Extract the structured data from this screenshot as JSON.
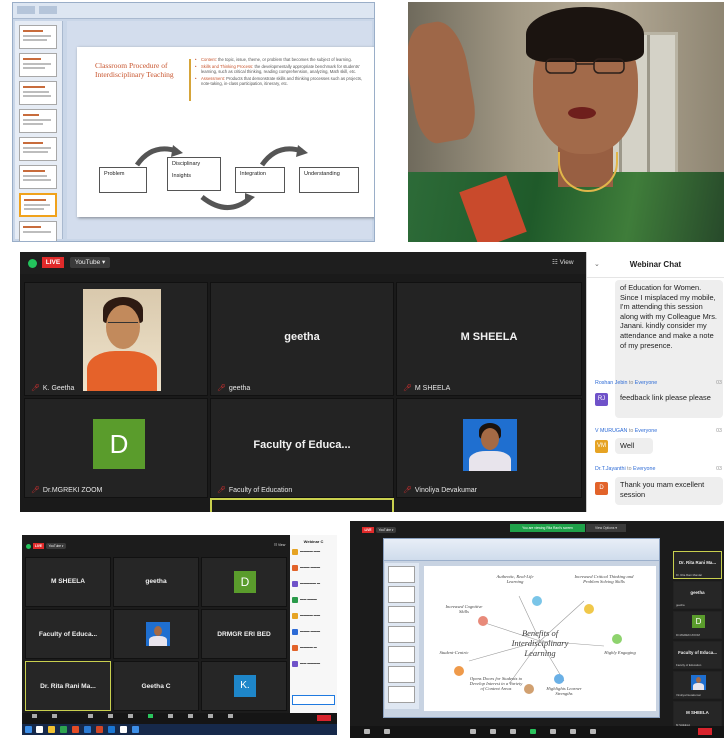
{
  "panel1": {
    "slide_title": "Classroom Procedure of Interdisciplinary Teaching",
    "bullets": [
      {
        "key": "Content:",
        "text": "the topic, issue, theme, or problem that becomes the subject of learning."
      },
      {
        "key": "Skills and Thinking Process:",
        "text": "the developmentally appropriate benchmark for students' learning, such as critical thinking, reading comprehension, analyzing, Math skill, etc."
      },
      {
        "key": "Assessment:",
        "text": "Products that demonstrate skills and thinking processes such as projects, note-taking, in-class participation, itinerary, etc."
      }
    ],
    "flow": {
      "problem": "Problem",
      "disciplinary": "Disciplinary",
      "insights": "Insights",
      "integration": "Integration",
      "understanding": "Understanding"
    }
  },
  "panel3": {
    "live": "LIVE",
    "youtube": "YouTube ▾",
    "view": "☷ View",
    "tiles": [
      {
        "name": "",
        "label": "K. Geetha"
      },
      {
        "name": "geetha",
        "label": "geetha"
      },
      {
        "name": "M SHEELA",
        "label": "M SHEELA"
      },
      {
        "name": "",
        "label": "Dr.MGREKI ZOOM",
        "avatar": "D"
      },
      {
        "name": "Faculty of Educa...",
        "label": "Faculty of Education"
      },
      {
        "name": "",
        "label": "Vinoliya Devakumar"
      }
    ],
    "chat": {
      "title": "Webinar Chat",
      "collapse": "⌄",
      "first_message": "of Education for Women. Since I misplaced my mobile, I'm attending this session along with my Colleague Mrs. Janani. kindly consider my attendance and make a note of my presence.",
      "messages": [
        {
          "sender": "Roshan Jebin",
          "to": "to",
          "recipient": "Everyone",
          "time": "03",
          "avatar": "RJ",
          "avatar_color": "#6f52c9",
          "text": "feedback link please please"
        },
        {
          "sender": "V MURUGAN",
          "to": "to",
          "recipient": "Everyone",
          "time": "03",
          "avatar": "VM",
          "avatar_color": "#e6a323",
          "text": "Well"
        },
        {
          "sender": "Dr.T.Jayanthi",
          "to": "to",
          "recipient": "Everyone",
          "time": "03",
          "avatar": "D",
          "avatar_color": "#e2632a",
          "text": "Thank you mam excellent session"
        }
      ]
    }
  },
  "panel4": {
    "tiles": [
      {
        "name": "M SHEELA"
      },
      {
        "name": "geetha"
      },
      {
        "name": "",
        "avatar": "D"
      },
      {
        "name": "Faculty of Educa..."
      },
      {
        "name": ""
      },
      {
        "name": "DRMGR ERI BED"
      },
      {
        "name": "Dr. Rita Rani Ma..."
      },
      {
        "name": "Geetha C"
      },
      {
        "name": "",
        "avatar": "K."
      }
    ],
    "chat_title": "Webinar C"
  },
  "panel5": {
    "share_banner": "You are viewing Rita Rani's screen",
    "view_options": "View Options ▾",
    "slide": {
      "center_title": "Benefits of Interdisciplinary Learning",
      "items": [
        "Authentic, Real-Life Learning",
        "Increased Critical Thinking and Problem Solving Skills",
        "Increased Cognitive Skills",
        "Highly Engaging",
        "Student-Centric",
        "Highlights Learner Strengths",
        "Opens Doors for Students to Develop Interest in a Variety of Content Areas"
      ]
    },
    "side": [
      {
        "name": "Dr. Rita Rani Ma...",
        "label": "Dr. Rita Rani Mandal"
      },
      {
        "name": "geetha",
        "label": "geetha"
      },
      {
        "name": "",
        "label": "Dr.MGREKI ZOOM",
        "avatar": "D"
      },
      {
        "name": "Faculty of Educa...",
        "label": "Faculty of Education"
      },
      {
        "name": "",
        "label": "Vinoliya Devakumar"
      },
      {
        "name": "M SHEELA",
        "label": "M SHEELA"
      }
    ]
  }
}
